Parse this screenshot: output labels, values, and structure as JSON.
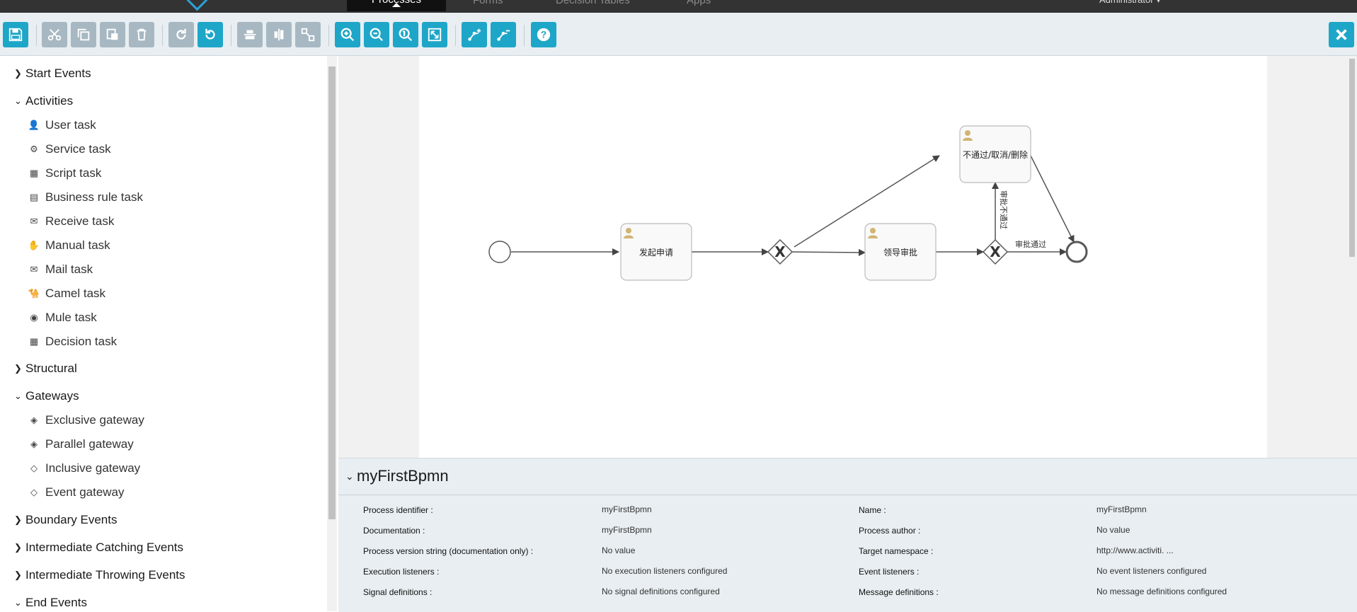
{
  "topnav": {
    "tabs": [
      {
        "label": "Processes",
        "active": true
      },
      {
        "label": "Forms"
      },
      {
        "label": "Decision Tables"
      },
      {
        "label": "Apps"
      }
    ],
    "user": "Administrator ▾"
  },
  "toolbar": {
    "icons": [
      "save-icon",
      "cut-icon",
      "copy-icon",
      "paste-icon",
      "delete-icon",
      "redo-icon",
      "undo-icon",
      "align-horizontal-icon",
      "align-vertical-icon",
      "same-size-icon",
      "zoom-in-icon",
      "zoom-out-icon",
      "zoom-actual-icon",
      "zoom-fit-icon",
      "bend-add-icon",
      "bend-remove-icon",
      "help-icon",
      "close-icon"
    ],
    "accent_color": "#1ea6c8",
    "disabled_color": "#a7b8c2"
  },
  "palette": {
    "groups": [
      {
        "label": "Start Events",
        "expanded": false
      },
      {
        "label": "Activities",
        "expanded": true,
        "items": [
          {
            "label": "User task",
            "icon": "user-icon"
          },
          {
            "label": "Service task",
            "icon": "gear-icon"
          },
          {
            "label": "Script task",
            "icon": "script-icon"
          },
          {
            "label": "Business rule task",
            "icon": "table-icon"
          },
          {
            "label": "Receive task",
            "icon": "envelope-icon"
          },
          {
            "label": "Manual task",
            "icon": "hand-icon"
          },
          {
            "label": "Mail task",
            "icon": "mail-icon"
          },
          {
            "label": "Camel task",
            "icon": "camel-icon"
          },
          {
            "label": "Mule task",
            "icon": "mule-icon"
          },
          {
            "label": "Decision task",
            "icon": "grid-icon"
          }
        ]
      },
      {
        "label": "Structural",
        "expanded": false
      },
      {
        "label": "Gateways",
        "expanded": true,
        "items": [
          {
            "label": "Exclusive gateway",
            "icon": "exclusive-gateway-icon"
          },
          {
            "label": "Parallel gateway",
            "icon": "parallel-gateway-icon"
          },
          {
            "label": "Inclusive gateway",
            "icon": "inclusive-gateway-icon"
          },
          {
            "label": "Event gateway",
            "icon": "event-gateway-icon"
          }
        ]
      },
      {
        "label": "Boundary Events",
        "expanded": false
      },
      {
        "label": "Intermediate Catching Events",
        "expanded": false
      },
      {
        "label": "Intermediate Throwing Events",
        "expanded": false
      },
      {
        "label": "End Events",
        "expanded": true
      }
    ]
  },
  "diagram": {
    "tasks": {
      "apply": "发起申请",
      "leader": "领导审批",
      "reject": "不通过/取消/删除"
    },
    "flows": {
      "not_pass": "审批不通过",
      "pass": "审批通过"
    },
    "gateway_marker": "X"
  },
  "properties": {
    "title": "myFirstBpmn",
    "left": [
      {
        "label": "Process identifier :",
        "value": "myFirstBpmn"
      },
      {
        "label": "Documentation :",
        "value": "myFirstBpmn"
      },
      {
        "label": "Process version string (documentation only) :",
        "value": "No value"
      },
      {
        "label": "Execution listeners :",
        "value": "No execution listeners configured"
      },
      {
        "label": "Signal definitions :",
        "value": "No signal definitions configured"
      }
    ],
    "right": [
      {
        "label": "Name :",
        "value": "myFirstBpmn"
      },
      {
        "label": "Process author :",
        "value": "No value"
      },
      {
        "label": "Target namespace :",
        "value": "http://www.activiti. ..."
      },
      {
        "label": "Event listeners :",
        "value": "No event listeners configured"
      },
      {
        "label": "Message definitions :",
        "value": "No message definitions configured"
      }
    ]
  }
}
